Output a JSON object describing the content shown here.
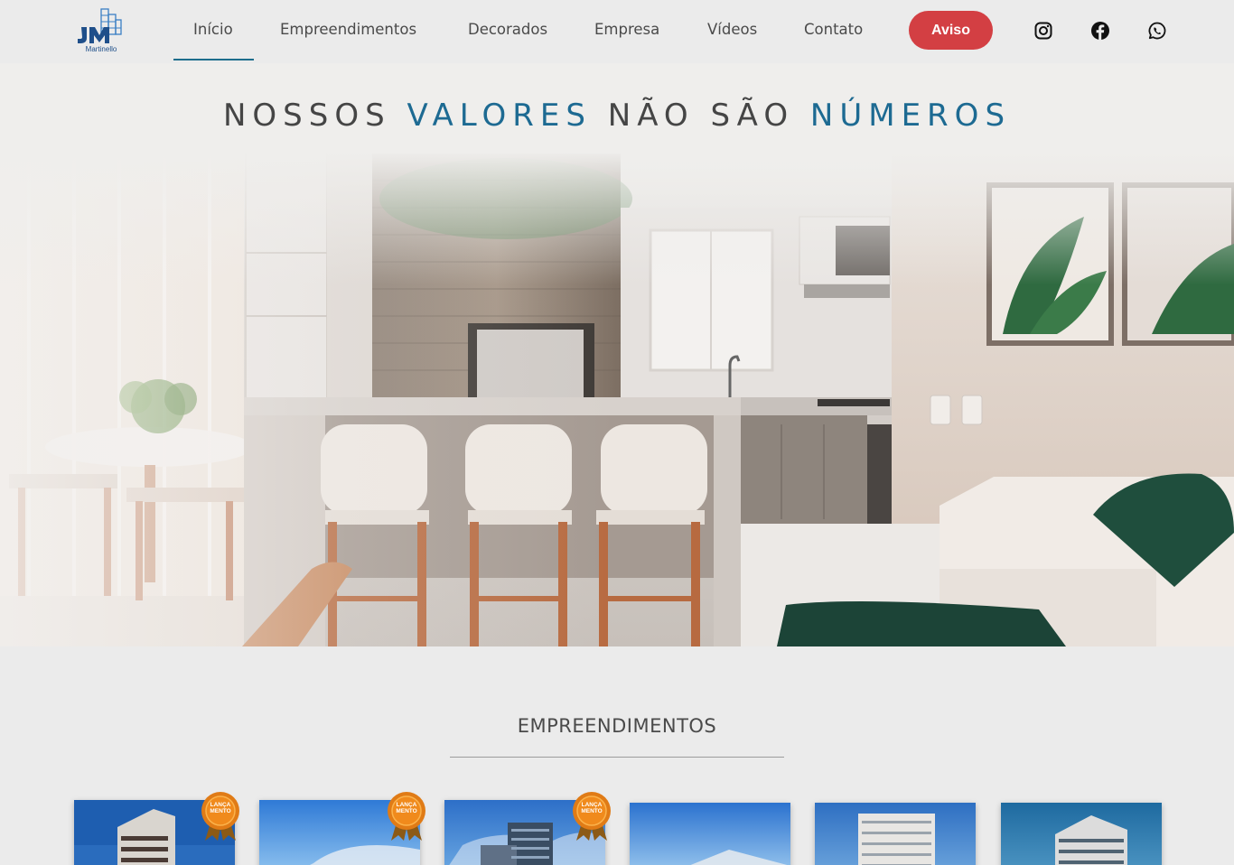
{
  "brand": {
    "logo_letters": "JM",
    "logo_subtitle": "Martinello",
    "logo_color": "#1f4f8a"
  },
  "nav": {
    "items": [
      {
        "label": "Início",
        "active": true
      },
      {
        "label": "Empreendimentos",
        "active": false
      },
      {
        "label": "Decorados",
        "active": false
      },
      {
        "label": "Empresa",
        "active": false
      },
      {
        "label": "Vídeos",
        "active": false
      },
      {
        "label": "Contato",
        "active": false
      }
    ],
    "accent_color": "#1d6d8c"
  },
  "aviso_button": {
    "label": "Aviso",
    "color": "#d33f43"
  },
  "social": [
    {
      "icon": "instagram-icon"
    },
    {
      "icon": "facebook-icon"
    },
    {
      "icon": "whatsapp-icon"
    }
  ],
  "hero": {
    "title_parts": [
      {
        "text": "NOSSOS ",
        "accent": false
      },
      {
        "text": "VALORES",
        "accent": true
      },
      {
        "text": " NÃO SÃO ",
        "accent": false
      },
      {
        "text": "NÚMEROS",
        "accent": true
      }
    ],
    "accent_color": "#1d6a92"
  },
  "section": {
    "title": "EMPREENDIMENTOS"
  },
  "projects": [
    {
      "badge": "LANÇAMENTO",
      "badge_lines": [
        "LANÇA",
        "MENTO"
      ],
      "has_badge": true
    },
    {
      "badge": "LANÇAMENTO",
      "badge_lines": [
        "LANÇA",
        "MENTO"
      ],
      "has_badge": true
    },
    {
      "badge": "LANÇAMENTO",
      "badge_lines": [
        "LANÇA",
        "MENTO"
      ],
      "has_badge": true
    },
    {
      "has_badge": false
    },
    {
      "has_badge": false
    },
    {
      "has_badge": false
    }
  ]
}
